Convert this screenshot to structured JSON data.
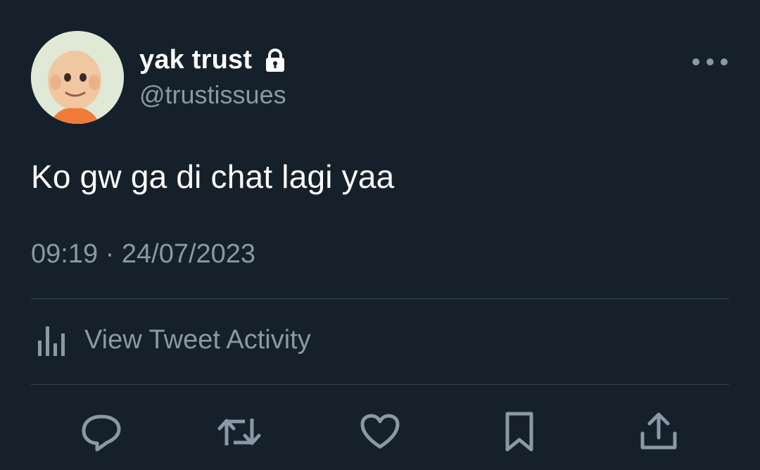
{
  "tweet": {
    "display_name": "yak trust",
    "handle": "@trustissues",
    "text": "Ko gw ga di chat lagi yaa",
    "timestamp": "09:19 · 24/07/2023",
    "activity_label": "View Tweet Activity",
    "protected": true
  },
  "icons": {
    "lock": "lock-icon",
    "more": "more-icon",
    "activity": "bar-chart-icon",
    "reply": "reply-icon",
    "retweet": "retweet-icon",
    "like": "heart-icon",
    "bookmark": "bookmark-icon",
    "share": "share-icon"
  },
  "colors": {
    "background": "#15202b",
    "primary_text": "#ffffff",
    "secondary_text": "#8b98a5",
    "divider": "#38444d"
  }
}
